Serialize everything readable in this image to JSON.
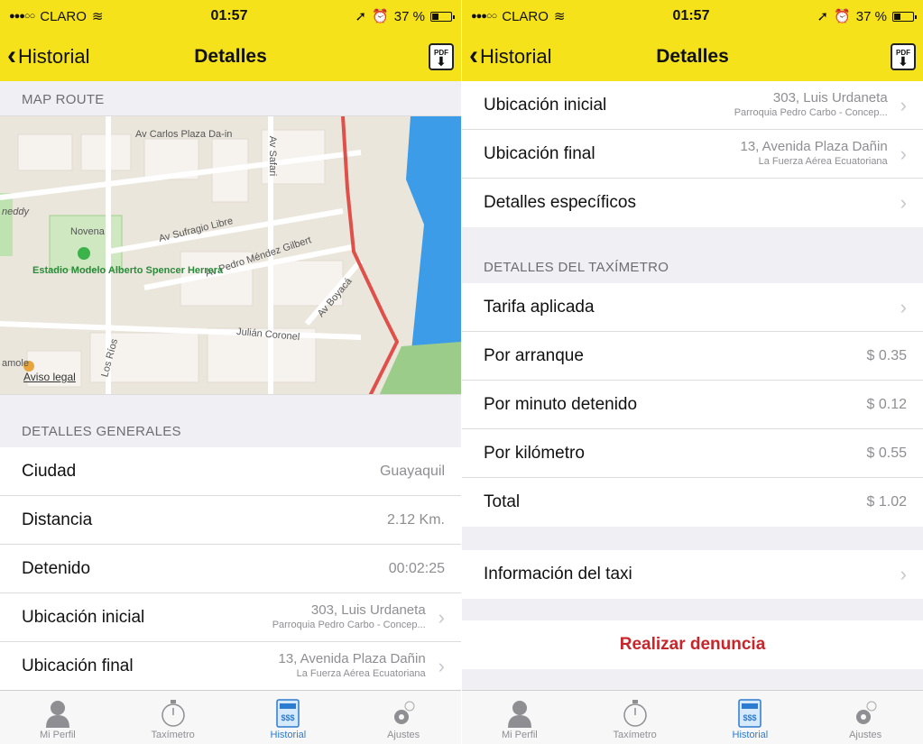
{
  "status_bar": {
    "carrier": "CLARO",
    "time": "01:57",
    "battery": "37 %",
    "battery_level": 0.37
  },
  "nav": {
    "back_label": "Historial",
    "title": "Detalles",
    "pdf_label": "PDF"
  },
  "left": {
    "map_header": "MAP ROUTE",
    "map_labels": {
      "street1": "Av Carlos Plaza Da-in",
      "street2": "Av Safari",
      "street3": "Av Sufragio Libre",
      "street4": "Av Pedro Méndez Gilbert",
      "street5": "Av Boyacá",
      "street6": "Julián Coronel",
      "street7": "Los Ríos",
      "place1": "Novena",
      "place2": "Estadio Modelo Alberto Spencer Herrera",
      "place3": "neddy",
      "place4": "amole",
      "legal": "Aviso legal"
    },
    "general_header": "DETALLES GENERALES",
    "rows": [
      {
        "label": "Ciudad",
        "value": "Guayaquil"
      },
      {
        "label": "Distancia",
        "value": "2.12 Km."
      },
      {
        "label": "Detenido",
        "value": "00:02:25"
      }
    ],
    "loc_start": {
      "label": "Ubicación inicial",
      "addr1": "303, Luis Urdaneta",
      "addr2": "Parroquia Pedro Carbo - Concep..."
    },
    "loc_end": {
      "label": "Ubicación final",
      "addr1": "13, Avenida Plaza Dañin",
      "addr2": "La Fuerza Aérea Ecuatoriana"
    }
  },
  "right": {
    "loc_start": {
      "label": "Ubicación inicial",
      "addr1": "303, Luis Urdaneta",
      "addr2": "Parroquia Pedro Carbo - Concep..."
    },
    "loc_end": {
      "label": "Ubicación final",
      "addr1": "13, Avenida Plaza Dañin",
      "addr2": "La Fuerza Aérea Ecuatoriana"
    },
    "specific": "Detalles específicos",
    "meter_header": "DETALLES DEL TAXÍMETRO",
    "tarifa": "Tarifa aplicada",
    "meter_rows": [
      {
        "label": "Por arranque",
        "value": "$ 0.35"
      },
      {
        "label": "Por minuto detenido",
        "value": "$ 0.12"
      },
      {
        "label": "Por kilómetro",
        "value": "$ 0.55"
      },
      {
        "label": "Total",
        "value": "$ 1.02"
      }
    ],
    "taxi_info": "Información del taxi",
    "denuncia": "Realizar denuncia"
  },
  "tabs": [
    {
      "label": "Mi Perfil",
      "icon": "person-icon"
    },
    {
      "label": "Taxímetro",
      "icon": "stopwatch-icon"
    },
    {
      "label": "Historial",
      "icon": "receipt-icon"
    },
    {
      "label": "Ajustes",
      "icon": "gear-icon"
    }
  ],
  "colors": {
    "nav_bg": "#f6e21a",
    "active_tab": "#2b7bd0",
    "denuncia": "#c8252b",
    "route": "#e0504a",
    "water": "#3d9ce8"
  }
}
